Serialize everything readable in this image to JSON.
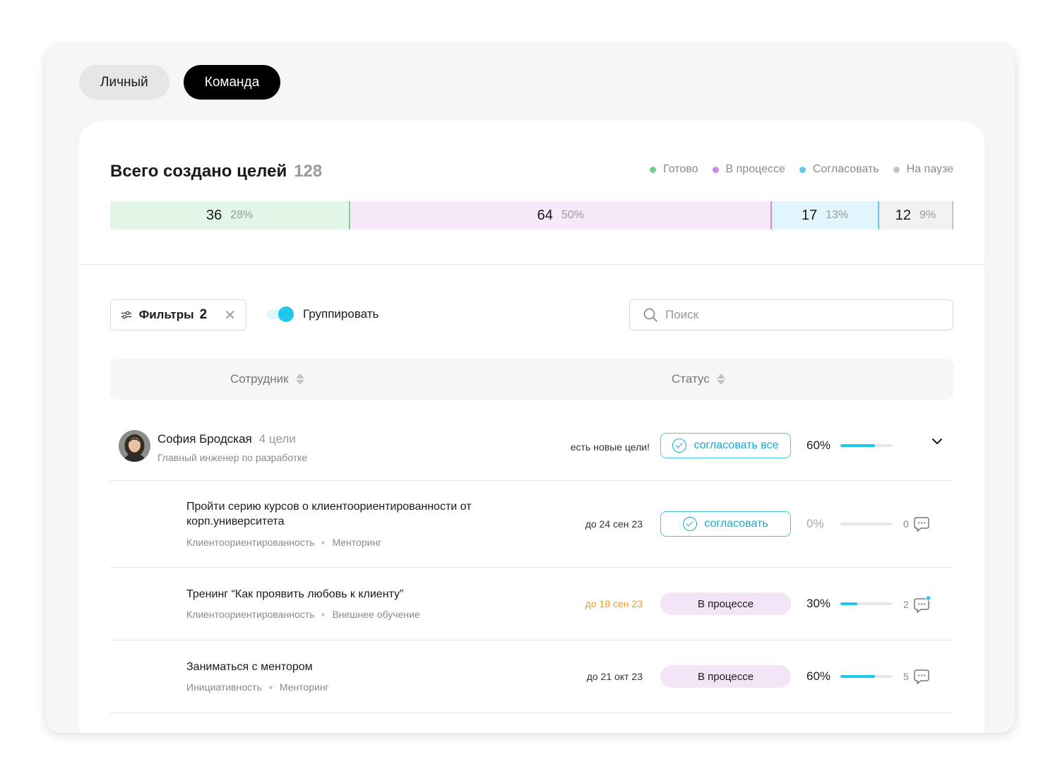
{
  "tabs": [
    {
      "label": "Личный",
      "active": false
    },
    {
      "label": "Команда",
      "active": true
    }
  ],
  "summary": {
    "title": "Всего создано целей",
    "total": "128",
    "legend": [
      {
        "label": "Готово",
        "color": "#6fd28c"
      },
      {
        "label": "В процессе",
        "color": "#c98be6"
      },
      {
        "label": "Согласовать",
        "color": "#5cc9f0"
      },
      {
        "label": "На паузе",
        "color": "#c4c4c4"
      }
    ],
    "segments": [
      {
        "count": "36",
        "percent": "28%",
        "share": 0.285,
        "bg": "#e1f6e6",
        "edge": "#7ed49a"
      },
      {
        "count": "64",
        "percent": "50%",
        "share": 0.5,
        "bg": "#f6e9f9",
        "edge": "#c98be6"
      },
      {
        "count": "17",
        "percent": "13%",
        "share": 0.127,
        "bg": "#e0f5fc",
        "edge": "#5cc9f0"
      },
      {
        "count": "12",
        "percent": "9%",
        "share": 0.088,
        "bg": "#f2f2f2",
        "edge": "#c4c4c4"
      }
    ]
  },
  "toolbar": {
    "filters_label": "Фильтры",
    "filters_count": "2",
    "group_label": "Группировать",
    "group_enabled": true,
    "search_placeholder": "Поиск"
  },
  "table": {
    "col_employee": "Сотрудник",
    "col_status": "Статус"
  },
  "employee": {
    "name": "София Бродская",
    "goals": "4 цели",
    "role": "Главный инженер по разработке",
    "note": "есть новые цели!",
    "approve_all_label": "согласовать все",
    "progress": "60%",
    "progress_value": 0.66
  },
  "goals": [
    {
      "title": "Пройти серию курсов о клиентоориентированности от корп.университета",
      "tags": [
        "Клиентоориентированность",
        "Менторинг"
      ],
      "due": "до 24 сен 23",
      "overdue": false,
      "status_type": "approve",
      "status_label": "согласовать",
      "progress": "0%",
      "progress_value": 0,
      "comments": "0",
      "new_comment": false
    },
    {
      "title": "Тренинг “Как проявить любовь к клиенту”",
      "tags": [
        "Клиентоориентированность",
        "Внешнее обучение"
      ],
      "due": "до 18 сен 23",
      "overdue": true,
      "status_type": "pill",
      "status_label": "В процессе",
      "progress": "30%",
      "progress_value": 0.33,
      "comments": "2",
      "new_comment": true
    },
    {
      "title": "Заниматься с ментором",
      "tags": [
        "Инициативность",
        "Менторинг"
      ],
      "due": "до 21 окт 23",
      "overdue": false,
      "status_type": "pill",
      "status_label": "В процессе",
      "progress": "60%",
      "progress_value": 0.66,
      "comments": "5",
      "new_comment": false
    }
  ]
}
